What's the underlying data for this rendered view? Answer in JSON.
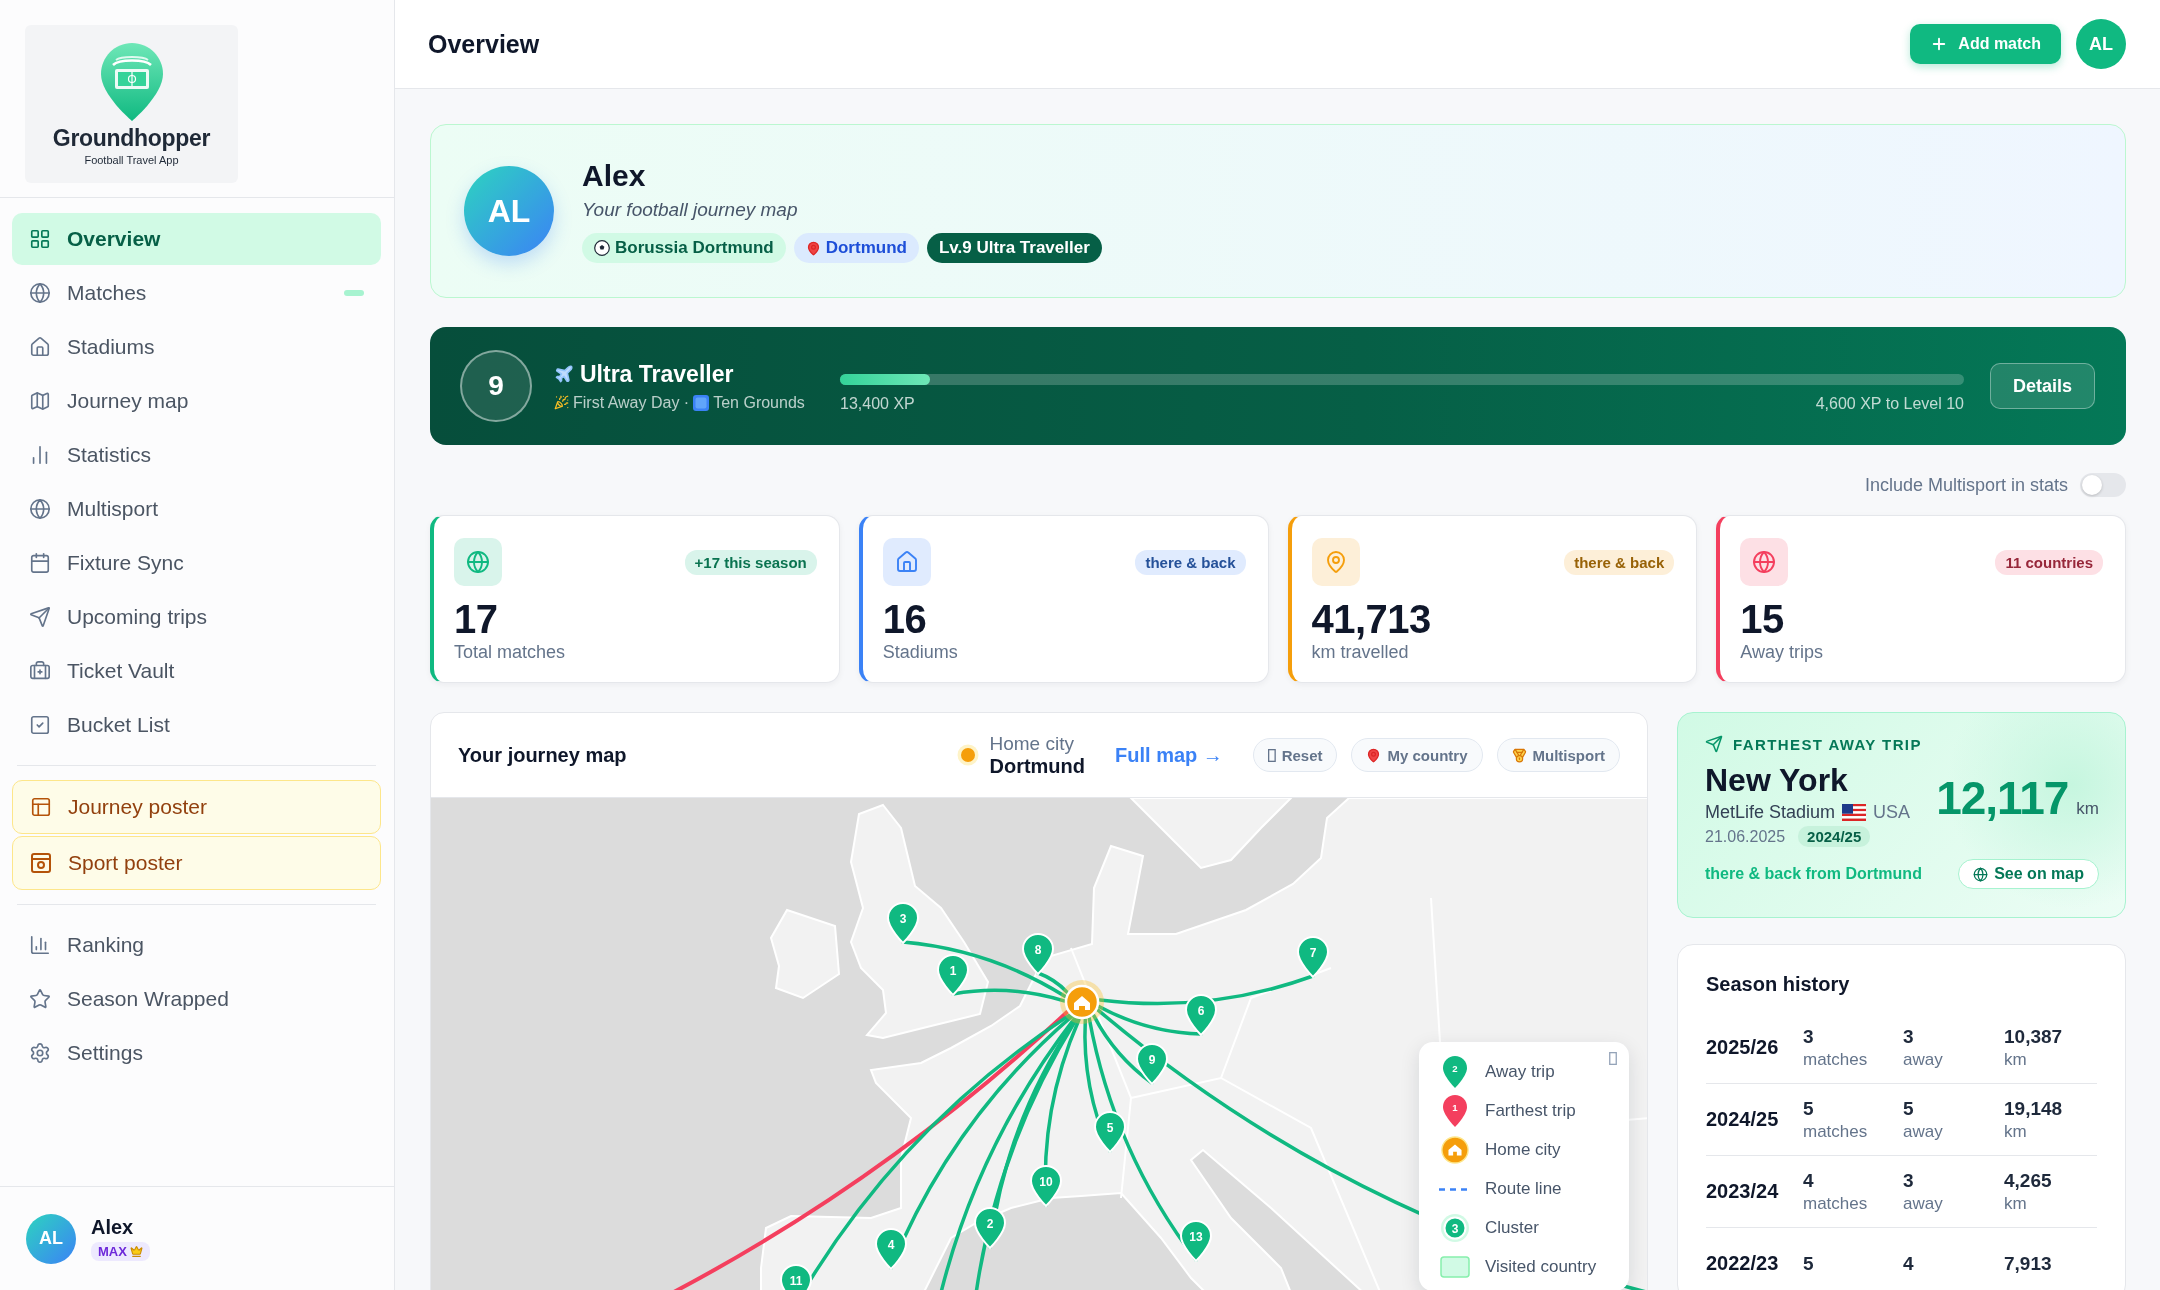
{
  "sidebar": {
    "logo": {
      "title": "Groundhopper",
      "subtitle": "Football Travel App"
    },
    "nav_groups": [
      [
        {
          "label": "Overview",
          "kind": "link",
          "selected": true,
          "indicator": false
        },
        {
          "label": "Matches",
          "kind": "link",
          "selected": false,
          "indicator": true
        },
        {
          "label": "Stadiums",
          "kind": "link",
          "selected": false,
          "indicator": false
        },
        {
          "label": "Journey map",
          "kind": "link",
          "selected": false,
          "indicator": false
        },
        {
          "label": "Statistics",
          "kind": "link",
          "selected": false,
          "indicator": false
        },
        {
          "label": "Multisport",
          "kind": "link",
          "selected": false,
          "indicator": false
        },
        {
          "label": "Fixture Sync",
          "kind": "link",
          "selected": false,
          "indicator": false
        },
        {
          "label": "Upcoming trips",
          "kind": "link",
          "selected": false,
          "indicator": false
        },
        {
          "label": "Ticket Vault",
          "kind": "link",
          "selected": false,
          "indicator": false
        },
        {
          "label": "Bucket List",
          "kind": "link",
          "selected": false,
          "indicator": false
        }
      ],
      [
        {
          "label": "Journey poster",
          "kind": "poster",
          "selected": false,
          "indicator": false
        },
        {
          "label": "Sport poster",
          "kind": "poster",
          "selected": false,
          "indicator": false
        }
      ],
      [
        {
          "label": "Ranking",
          "kind": "link",
          "selected": false,
          "indicator": false
        },
        {
          "label": "Season Wrapped",
          "kind": "link",
          "selected": false,
          "indicator": false
        },
        {
          "label": "Settings",
          "kind": "link",
          "selected": false,
          "indicator": false
        }
      ]
    ],
    "user": {
      "initials": "AL",
      "name": "Alex",
      "badge": "MAX"
    }
  },
  "header": {
    "title": "Overview",
    "add_button": "Add match",
    "avatar": "AL"
  },
  "profile": {
    "initials": "AL",
    "name": "Alex",
    "tagline": "Your football journey map",
    "tags": [
      {
        "kind": "club",
        "label": "Borussia Dortmund"
      },
      {
        "kind": "city",
        "label": "Dortmund"
      },
      {
        "kind": "level",
        "label": "Lv.9 Ultra Traveller"
      }
    ]
  },
  "level_banner": {
    "level": "9",
    "title": "Ultra Traveller",
    "achievements": [
      "First Away Day",
      "Ten Grounds"
    ],
    "separator": "·",
    "progress": {
      "level": 0.08
    },
    "xp": "13,400 XP",
    "xp_to_next": "4,600 XP to Level 10",
    "details_button": "Details"
  },
  "multisport_toggle": {
    "label": "Include Multisport in stats",
    "on": false
  },
  "stats": [
    {
      "value": "17",
      "label": "Total matches",
      "badge": "+17 this season",
      "color": "#10b981"
    },
    {
      "value": "16",
      "label": "Stadiums",
      "badge": "there & back",
      "color": "#3b82f6"
    },
    {
      "value": "41,713",
      "label": "km travelled",
      "badge": "there & back",
      "color": "#f59e0b"
    },
    {
      "value": "15",
      "label": "Away trips",
      "badge": "11 countries",
      "color": "#f43f5e"
    }
  ],
  "journey_map": {
    "title": "Your journey map",
    "home_label": "Home city",
    "home_city": "Dortmund",
    "full_map_link": "Full map →",
    "buttons": [
      "Reset",
      "My country",
      "Multisport"
    ],
    "markers": [
      "3",
      "1",
      "8",
      "6",
      "7",
      "9",
      "5",
      "10",
      "2",
      "4",
      "13",
      "11"
    ],
    "legend": [
      {
        "kind": "away",
        "label": "Away trip",
        "sample": "2"
      },
      {
        "kind": "farthest",
        "label": "Farthest trip",
        "sample": "1"
      },
      {
        "kind": "home",
        "label": "Home city"
      },
      {
        "kind": "route",
        "label": "Route line"
      },
      {
        "kind": "cluster",
        "label": "Cluster",
        "sample": "3"
      },
      {
        "kind": "visited",
        "label": "Visited country"
      }
    ]
  },
  "farthest_trip": {
    "heading": "FARTHEST AWAY TRIP",
    "city": "New York",
    "stadium": "MetLife Stadium",
    "country": "USA",
    "date": "21.06.2025",
    "season": "2024/25",
    "distance": "12,117",
    "unit": "km",
    "note": "there & back from Dortmund",
    "button": "See on map"
  },
  "season_history": {
    "title": "Season history",
    "rows": [
      {
        "season": "2025/26",
        "matches": "3",
        "matches_label": "matches",
        "away": "3",
        "away_label": "away",
        "km": "10,387",
        "km_label": "km"
      },
      {
        "season": "2024/25",
        "matches": "5",
        "matches_label": "matches",
        "away": "5",
        "away_label": "away",
        "km": "19,148",
        "km_label": "km"
      },
      {
        "season": "2023/24",
        "matches": "4",
        "matches_label": "matches",
        "away": "3",
        "away_label": "away",
        "km": "4,265",
        "km_label": "km"
      },
      {
        "season": "2022/23",
        "matches": "5",
        "away": "4",
        "km": "7,913"
      }
    ]
  }
}
